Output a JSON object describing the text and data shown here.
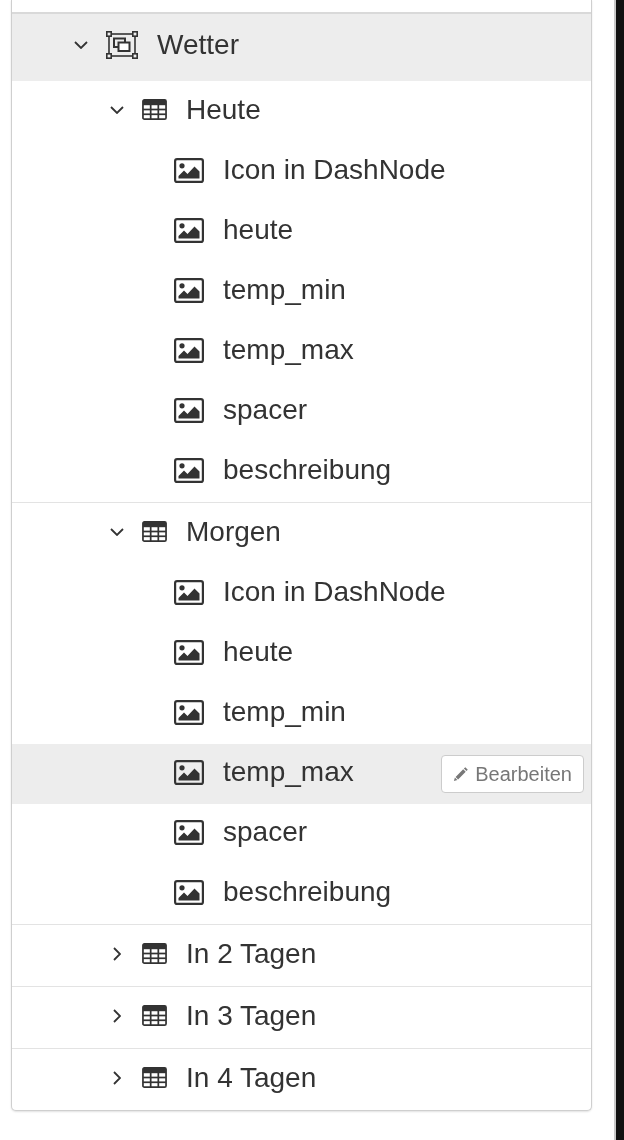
{
  "tree": {
    "items": [
      {
        "label": "Wetter",
        "kind": "group",
        "expanded": true,
        "highlighted": true,
        "children": [
          {
            "label": "Heute",
            "kind": "table",
            "expanded": true,
            "highlighted": false,
            "children": [
              {
                "label": "Icon in DashNode",
                "kind": "image",
                "highlighted": false
              },
              {
                "label": "heute",
                "kind": "image",
                "highlighted": false
              },
              {
                "label": "temp_min",
                "kind": "image",
                "highlighted": false
              },
              {
                "label": "temp_max",
                "kind": "image",
                "highlighted": false
              },
              {
                "label": "spacer",
                "kind": "image",
                "highlighted": false
              },
              {
                "label": "beschreibung",
                "kind": "image",
                "highlighted": false
              }
            ]
          },
          {
            "label": "Morgen",
            "kind": "table",
            "expanded": true,
            "highlighted": false,
            "children": [
              {
                "label": "Icon in DashNode",
                "kind": "image",
                "highlighted": false
              },
              {
                "label": "heute",
                "kind": "image",
                "highlighted": false
              },
              {
                "label": "temp_min",
                "kind": "image",
                "highlighted": false
              },
              {
                "label": "temp_max",
                "kind": "image",
                "highlighted": true,
                "edit_button": {
                  "label": "Bearbeiten"
                }
              },
              {
                "label": "spacer",
                "kind": "image",
                "highlighted": false
              },
              {
                "label": "beschreibung",
                "kind": "image",
                "highlighted": false
              }
            ]
          },
          {
            "label": "In 2 Tagen",
            "kind": "table",
            "expanded": false,
            "highlighted": false
          },
          {
            "label": "In 3 Tagen",
            "kind": "table",
            "expanded": false,
            "highlighted": false
          },
          {
            "label": "In 4 Tagen",
            "kind": "table",
            "expanded": false,
            "highlighted": false
          }
        ]
      }
    ]
  }
}
